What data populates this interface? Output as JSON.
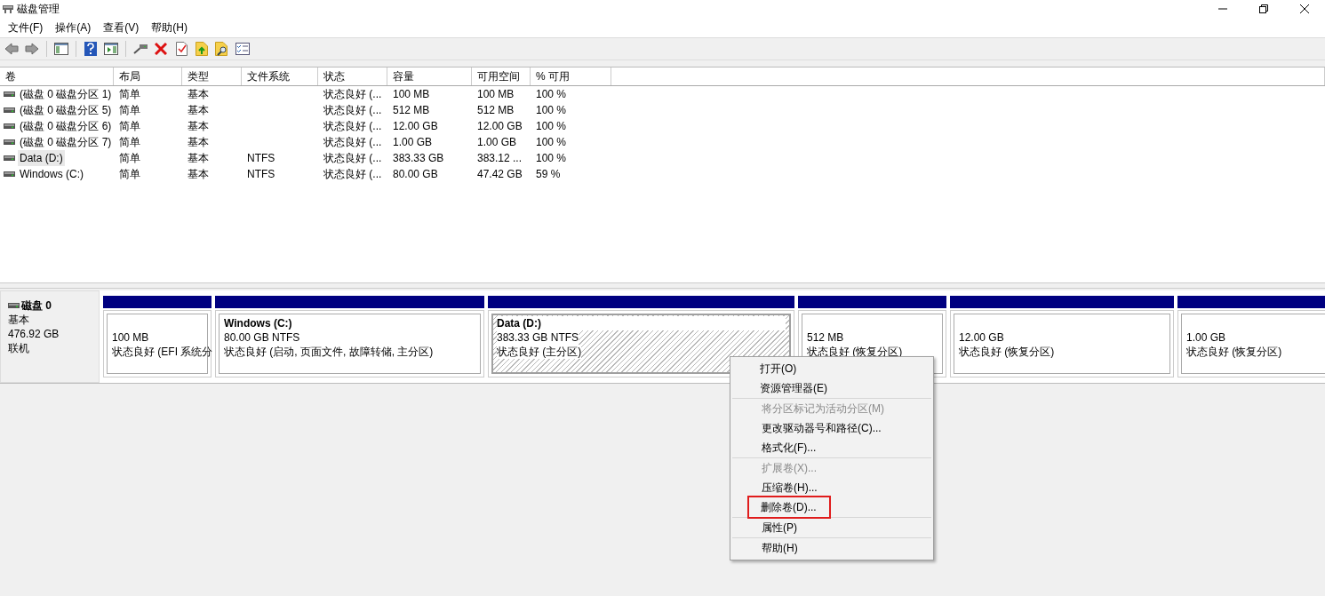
{
  "window": {
    "title": "磁盘管理"
  },
  "menubar": [
    "文件(F)",
    "操作(A)",
    "查看(V)",
    "帮助(H)"
  ],
  "volume_list": {
    "columns": [
      "卷",
      "布局",
      "类型",
      "文件系统",
      "状态",
      "容量",
      "可用空间",
      "% 可用"
    ],
    "rows": [
      {
        "selected": false,
        "cells": [
          "(磁盘 0 磁盘分区 1)",
          "简单",
          "基本",
          "",
          "状态良好 (...",
          "100 MB",
          "100 MB",
          "100 %"
        ]
      },
      {
        "selected": false,
        "cells": [
          "(磁盘 0 磁盘分区 5)",
          "简单",
          "基本",
          "",
          "状态良好 (...",
          "512 MB",
          "512 MB",
          "100 %"
        ]
      },
      {
        "selected": false,
        "cells": [
          "(磁盘 0 磁盘分区 6)",
          "简单",
          "基本",
          "",
          "状态良好 (...",
          "12.00 GB",
          "12.00 GB",
          "100 %"
        ]
      },
      {
        "selected": false,
        "cells": [
          "(磁盘 0 磁盘分区 7)",
          "简单",
          "基本",
          "",
          "状态良好 (...",
          "1.00 GB",
          "1.00 GB",
          "100 %"
        ]
      },
      {
        "selected": true,
        "cells": [
          "Data (D:)",
          "简单",
          "基本",
          "NTFS",
          "状态良好 (...",
          "383.33 GB",
          "383.12 ...",
          "100 %"
        ]
      },
      {
        "selected": false,
        "cells": [
          "Windows (C:)",
          "简单",
          "基本",
          "NTFS",
          "状态良好 (...",
          "80.00 GB",
          "47.42 GB",
          "59 %"
        ]
      }
    ]
  },
  "disk": {
    "name": "磁盘 0",
    "type": "基本",
    "size": "476.92 GB",
    "status": "联机",
    "partitions": [
      {
        "selected": false,
        "lines": [
          "100 MB",
          "状态良好 (EFI 系统分"
        ]
      },
      {
        "selected": false,
        "title": "Windows  (C:)",
        "lines": [
          "80.00 GB NTFS",
          "状态良好 (启动, 页面文件, 故障转储, 主分区)"
        ]
      },
      {
        "selected": true,
        "title": "Data  (D:)",
        "lines": [
          "383.33 GB NTFS",
          "状态良好 (主分区)"
        ]
      },
      {
        "selected": false,
        "lines": [
          "512 MB",
          "状态良好 (恢复分区)"
        ]
      },
      {
        "selected": false,
        "lines": [
          "12.00 GB",
          "状态良好 (恢复分区)"
        ]
      },
      {
        "selected": false,
        "lines": [
          "1.00 GB",
          "状态良好 (恢复分区)"
        ]
      }
    ]
  },
  "context_menu": {
    "groups": [
      [
        {
          "label": "打开(O)",
          "disabled": false,
          "highlighted": false
        },
        {
          "label": "资源管理器(E)",
          "disabled": false,
          "highlighted": false
        }
      ],
      [
        {
          "label": "将分区标记为活动分区(M)",
          "disabled": true,
          "highlighted": false
        },
        {
          "label": "更改驱动器号和路径(C)...",
          "disabled": false,
          "highlighted": false
        },
        {
          "label": "格式化(F)...",
          "disabled": false,
          "highlighted": false
        }
      ],
      [
        {
          "label": "扩展卷(X)...",
          "disabled": true,
          "highlighted": false
        },
        {
          "label": "压缩卷(H)...",
          "disabled": false,
          "highlighted": false
        },
        {
          "label": "删除卷(D)...",
          "disabled": false,
          "highlighted": true
        }
      ],
      [
        {
          "label": "属性(P)",
          "disabled": false,
          "highlighted": false
        }
      ],
      [
        {
          "label": "帮助(H)",
          "disabled": false,
          "highlighted": false
        }
      ]
    ]
  }
}
